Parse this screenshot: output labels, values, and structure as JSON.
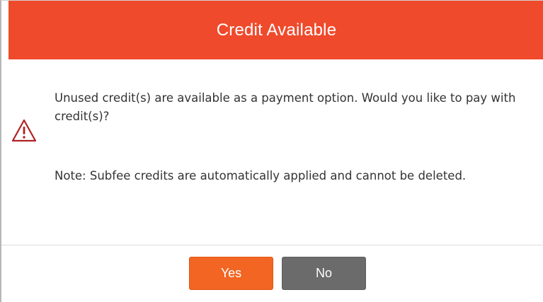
{
  "dialog": {
    "title": "Credit Available",
    "message": "Unused credit(s) are available as a payment option. Would you like to pay with credit(s)?",
    "note": "Note: Subfee credits are automatically applied and cannot be deleted.",
    "icon": "warning-triangle-icon",
    "colors": {
      "header": "#f04a2c",
      "yes_button": "#f26522",
      "no_button": "#6b6b6b",
      "icon": "#b22222"
    },
    "buttons": {
      "yes_label": "Yes",
      "no_label": "No"
    }
  }
}
